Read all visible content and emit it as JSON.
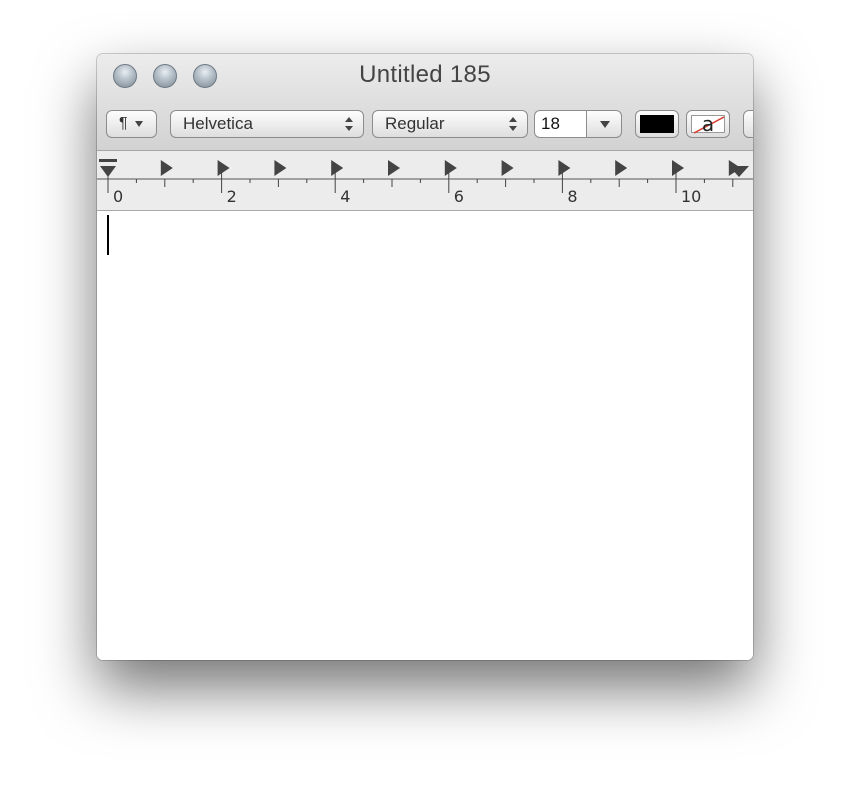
{
  "window": {
    "title": "Untitled 185"
  },
  "toolbar": {
    "paragraph_icon": "¶",
    "font_family": "Helvetica",
    "font_style": "Regular",
    "font_size": "18",
    "text_color": "#000000",
    "highlight_letter": "a",
    "highlight_strike_color": "#d63a2a"
  },
  "ruler": {
    "labels": [
      "0",
      "2",
      "4",
      "6",
      "8",
      "10"
    ]
  },
  "document": {
    "text": ""
  }
}
